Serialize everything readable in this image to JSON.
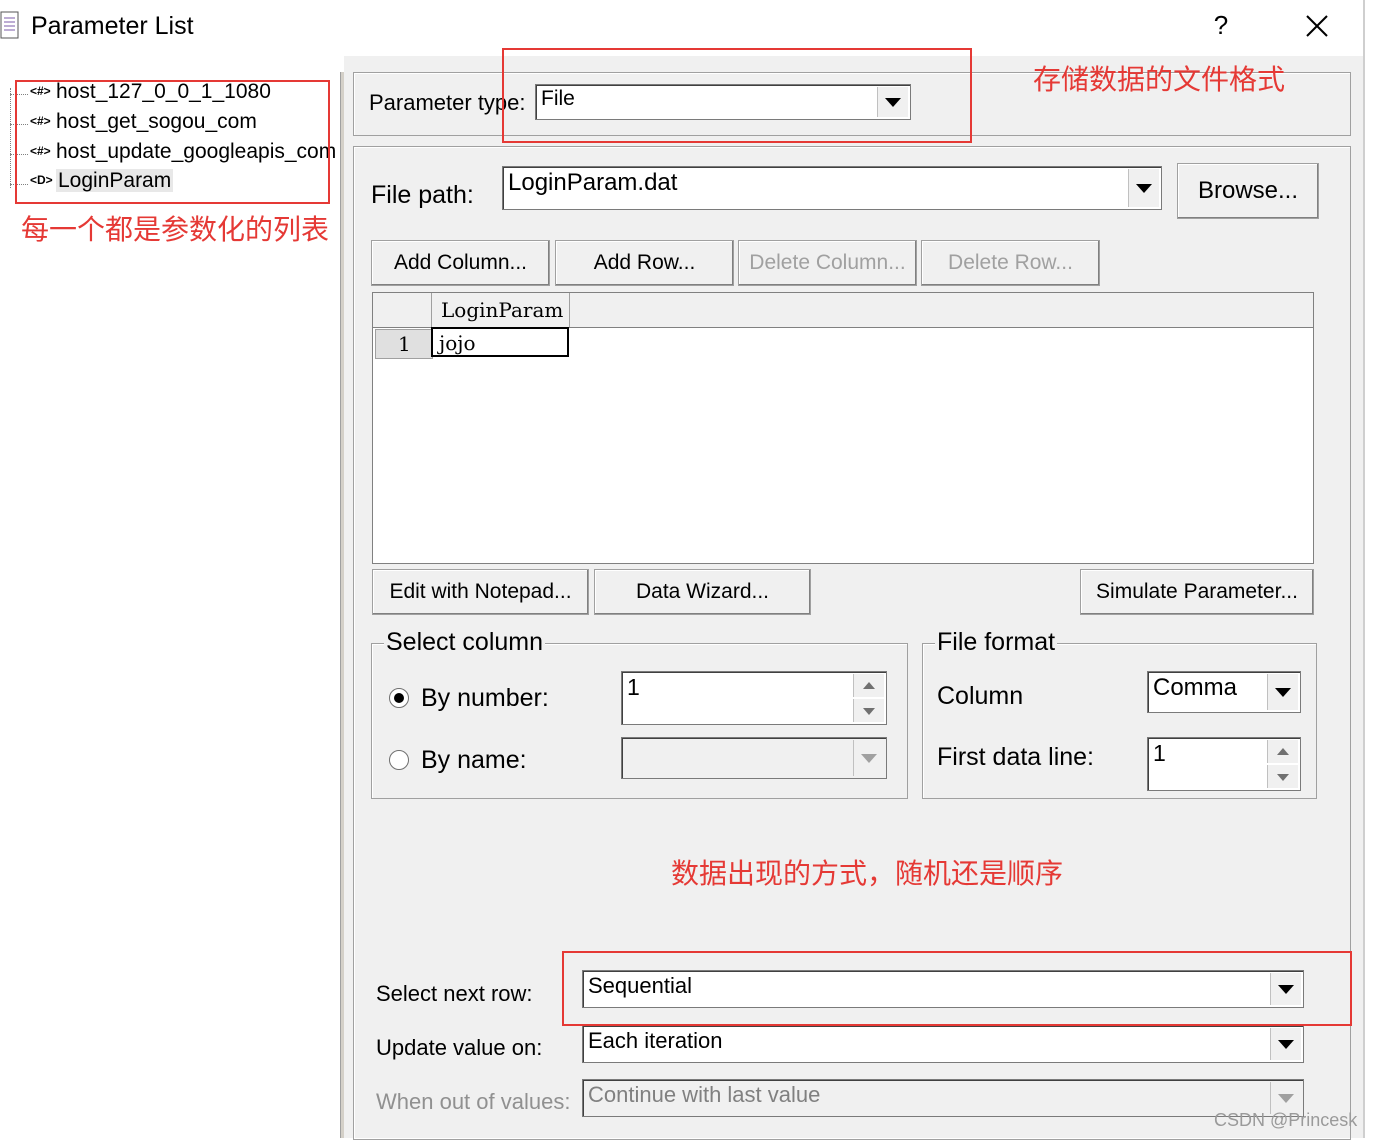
{
  "window": {
    "title": "Parameter List",
    "help": "?",
    "close": "✕"
  },
  "tree": {
    "items": [
      {
        "icon": "<#>",
        "label": "host_127_0_0_1_1080"
      },
      {
        "icon": "<#>",
        "label": "host_get_sogou_com"
      },
      {
        "icon": "<#>",
        "label": "host_update_googleapis_com"
      },
      {
        "icon": "<D>",
        "label": "LoginParam"
      }
    ]
  },
  "param_type": {
    "label": "Parameter type:",
    "value": "File"
  },
  "file_path": {
    "label": "File path:",
    "value": "LoginParam.dat",
    "browse": "Browse..."
  },
  "buttons": {
    "add_column": "Add Column...",
    "add_row": "Add Row...",
    "delete_column": "Delete Column...",
    "delete_row": "Delete Row...",
    "edit_notepad": "Edit with Notepad...",
    "data_wizard": "Data Wizard...",
    "simulate": "Simulate Parameter..."
  },
  "grid": {
    "columns": [
      "LoginParam"
    ],
    "rows": [
      {
        "num": "1",
        "cells": [
          "jojo"
        ]
      }
    ]
  },
  "select_column": {
    "title": "Select column",
    "by_number_label": "By number:",
    "by_number_value": "1",
    "by_name_label": "By name:",
    "by_name_value": ""
  },
  "file_format": {
    "title": "File format",
    "column_label": "Column",
    "column_value": "Comma",
    "first_line_label": "First data line:",
    "first_line_value": "1"
  },
  "next_row": {
    "label": "Select next row:",
    "value": "Sequential"
  },
  "update_value": {
    "label": "Update value on:",
    "value": "Each iteration"
  },
  "out_of_values": {
    "label": "When out of values:",
    "value": "Continue with last value"
  },
  "annotations": {
    "file_format_note": "存储数据的文件格式",
    "param_list_note": "每一个都是参数化的列表",
    "order_note": "数据出现的方式，随机还是顺序"
  },
  "watermark": "CSDN @Princesk",
  "colors": {
    "annotation": "#e53935",
    "panel": "#f0f0f0"
  }
}
